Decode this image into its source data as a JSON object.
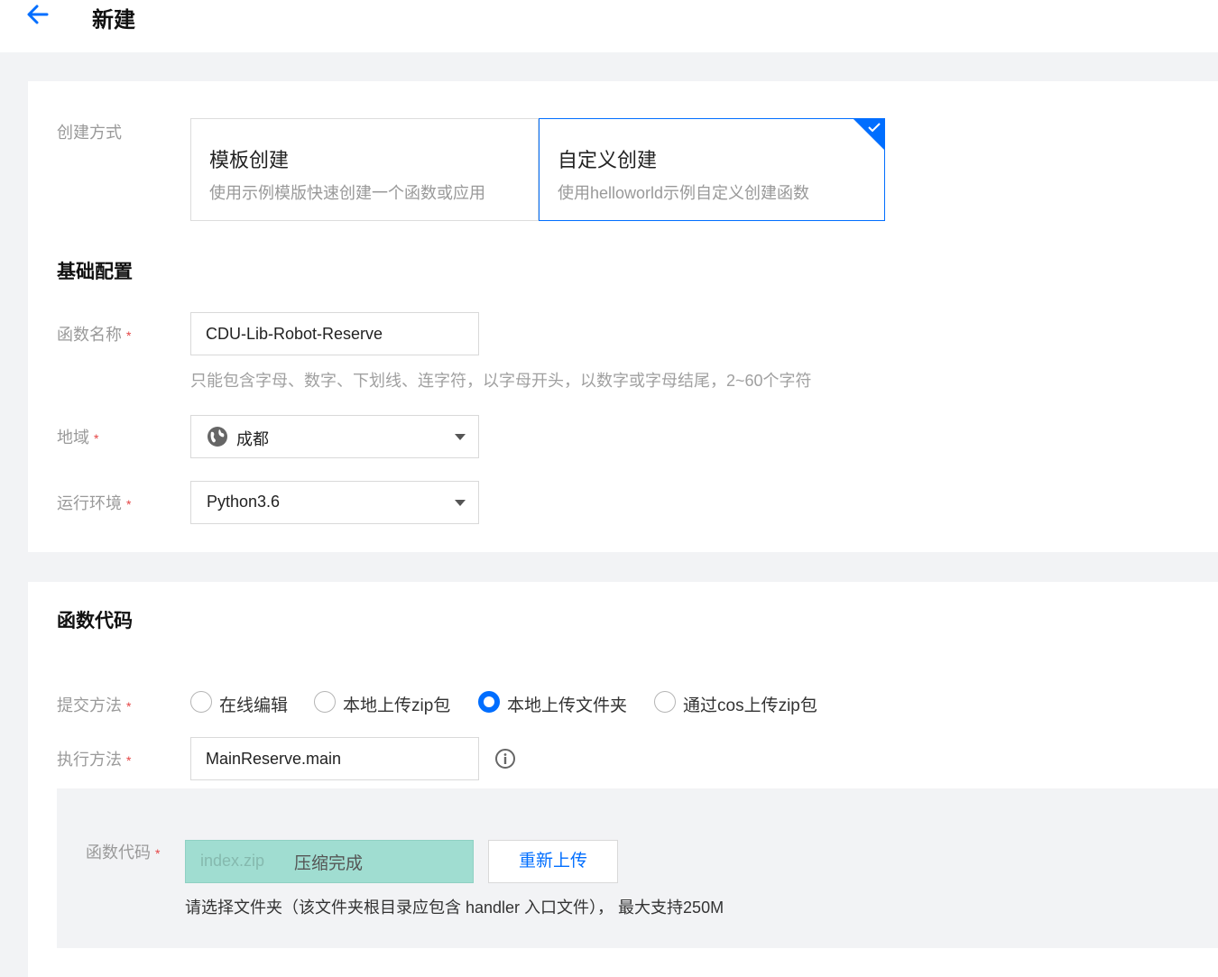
{
  "header": {
    "title": "新建",
    "back_icon": "arrow-left-icon"
  },
  "colors": {
    "accent": "#006eff",
    "required": "#e54545",
    "upload_success_bg": "#a0ddd1"
  },
  "create_method": {
    "label": "创建方式",
    "options": [
      {
        "title": "模板创建",
        "description": "使用示例模版快速创建一个函数或应用",
        "selected": false
      },
      {
        "title": "自定义创建",
        "description": "使用helloworld示例自定义创建函数",
        "selected": true
      }
    ]
  },
  "basic_config": {
    "title": "基础配置",
    "function_name": {
      "label": "函数名称",
      "required_mark": "*",
      "value": "CDU-Lib-Robot-Reserve",
      "hint": "只能包含字母、数字、下划线、连字符，以字母开头，以数字或字母结尾，2~60个字符"
    },
    "region": {
      "label": "地域",
      "required_mark": "*",
      "value": "成都",
      "icon": "globe-icon"
    },
    "runtime": {
      "label": "运行环境",
      "required_mark": "*",
      "value": "Python3.6"
    }
  },
  "function_code": {
    "title": "函数代码",
    "submit_method": {
      "label": "提交方法",
      "required_mark": "*",
      "options": [
        {
          "label": "在线编辑",
          "checked": false
        },
        {
          "label": "本地上传zip包",
          "checked": false
        },
        {
          "label": "本地上传文件夹",
          "checked": true
        },
        {
          "label": "通过cos上传zip包",
          "checked": false
        }
      ]
    },
    "handler": {
      "label": "执行方法",
      "required_mark": "*",
      "value": "MainReserve.main",
      "info_icon": "info-icon"
    },
    "code_upload": {
      "label": "函数代码",
      "required_mark": "*",
      "file_name": "index.zip",
      "status": "压缩完成",
      "reupload_label": "重新上传",
      "hint": "请选择文件夹（该文件夹根目录应包含 handler 入口文件），  最大支持250M"
    }
  }
}
